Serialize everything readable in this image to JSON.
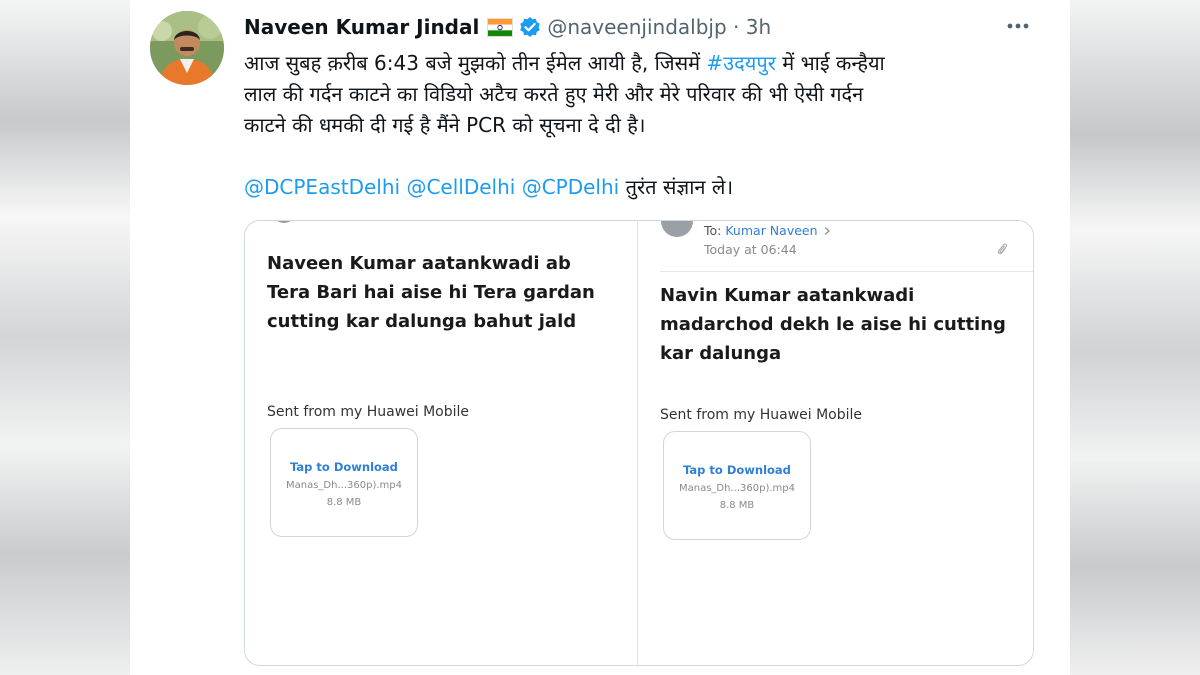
{
  "tweet": {
    "author_name": "Naveen Kumar Jindal",
    "handle_time": "@naveenjindalbjp · 3h",
    "lines": [
      {
        "segments": [
          {
            "text": "आज सुबह क़रीब 6:43 बजे मुझको तीन ईमेल आयी है, जिसमें ",
            "link": false
          },
          {
            "text": "#उदयपुर",
            "link": true
          },
          {
            "text": " में भाई कन्हैया",
            "link": false
          }
        ]
      },
      {
        "segments": [
          {
            "text": "लाल की गर्दन काटने का विडियो अटैच करते हुए मेरी और मेरे परिवार की भी ऐसी गर्दन",
            "link": false
          }
        ]
      },
      {
        "segments": [
          {
            "text": "काटने की धमकी दी गई है मैंने PCR को सूचना दे दी है।",
            "link": false
          }
        ]
      },
      {
        "segments": [
          {
            "text": "@DCPEastDelhi",
            "link": true
          },
          {
            "text": " ",
            "link": false
          },
          {
            "text": "@CellDelhi",
            "link": true
          },
          {
            "text": " ",
            "link": false
          },
          {
            "text": "@CPDelhi",
            "link": true
          },
          {
            "text": " तुरंत संज्ञान ले।",
            "link": false
          }
        ]
      }
    ]
  },
  "emails": {
    "left": {
      "message": "Naveen Kumar aatankwadi ab Tera Bari hai aise hi Tera gardan cutting kar dalunga bahut jald",
      "sent_from": "Sent from my Huawei Mobile",
      "attachment": {
        "action": "Tap to Download",
        "filename": "Manas_Dh...360p).mp4",
        "size": "8.8 MB"
      }
    },
    "right": {
      "to_label": "To:",
      "to_name": "Kumar Naveen",
      "time": "Today at 06:44",
      "message": "Navin Kumar aatankwadi madarchod dekh le aise hi cutting kar dalunga",
      "sent_from": "Sent from my Huawei Mobile",
      "attachment": {
        "action": "Tap to Download",
        "filename": "Manas_Dh...360p).mp4",
        "size": "8.8 MB"
      }
    }
  },
  "colors": {
    "link": "#1d9bf0",
    "verified": "#1d9bf0",
    "mail_link": "#2f7fd6"
  },
  "icons": [
    "india-flag-icon",
    "verified-badge-icon",
    "more-options-icon",
    "chevron-right-icon",
    "paperclip-icon",
    "sender-avatar-icon"
  ]
}
